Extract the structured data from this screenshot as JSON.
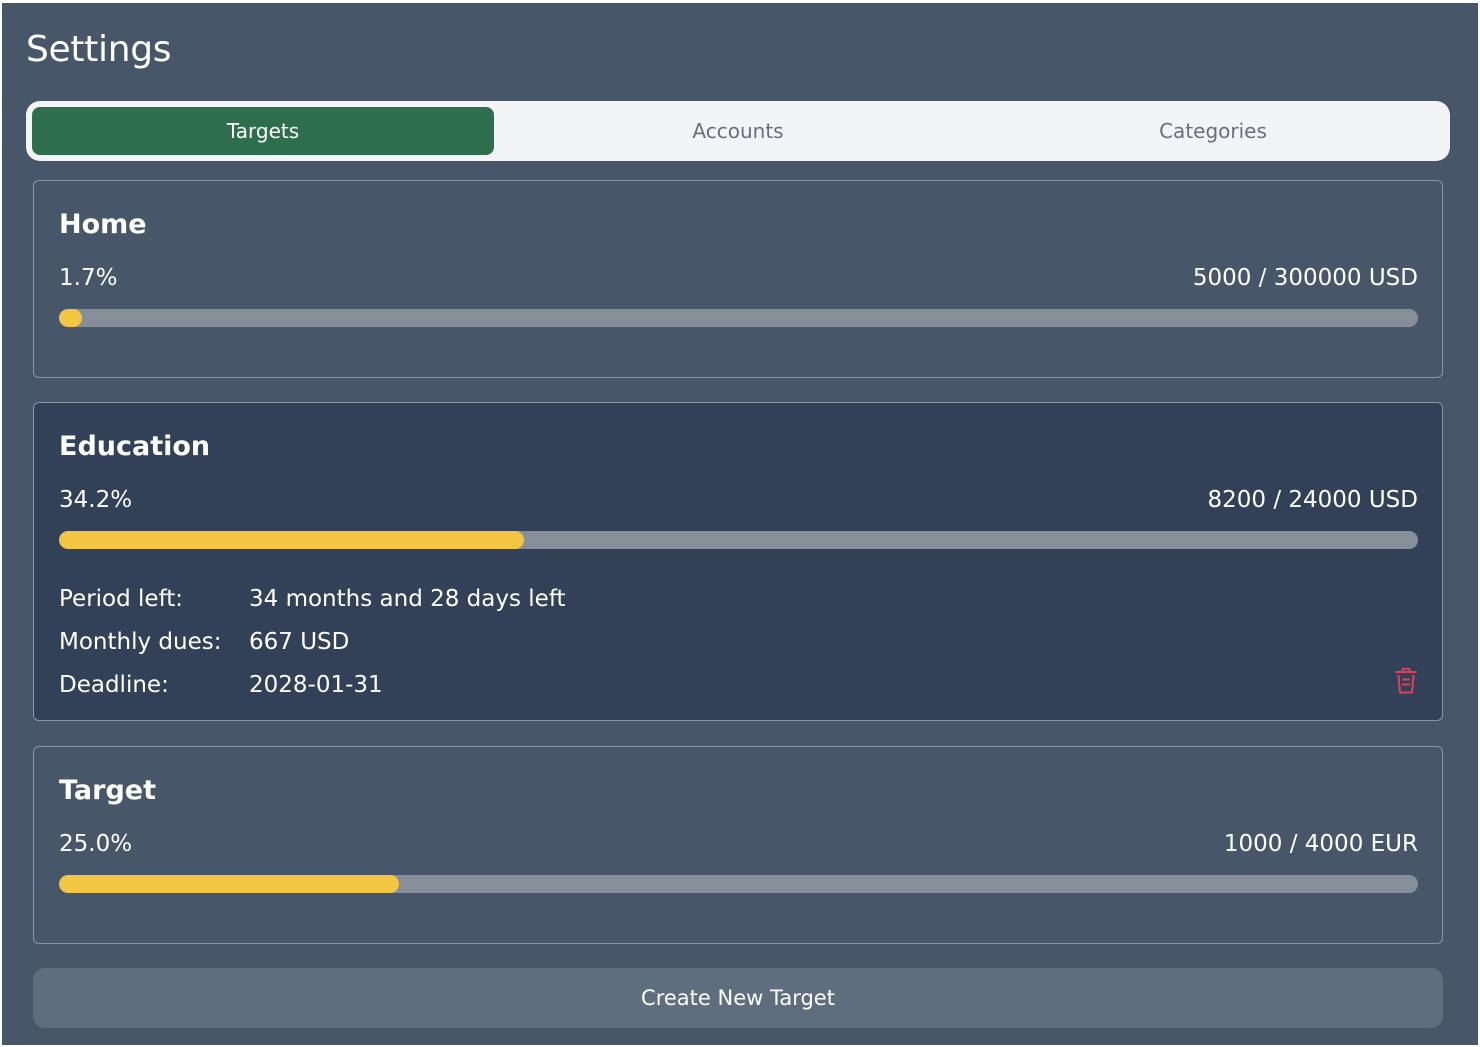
{
  "page": {
    "title": "Settings"
  },
  "tabs": [
    {
      "label": "Targets",
      "active": true
    },
    {
      "label": "Accounts",
      "active": false
    },
    {
      "label": "Categories",
      "active": false
    }
  ],
  "targets": [
    {
      "name": "Home",
      "percent_label": "1.7%",
      "amount_label": "5000 / 300000 USD",
      "progress": 0.017
    },
    {
      "name": "Education",
      "percent_label": "34.2%",
      "amount_label": "8200 / 24000 USD",
      "progress": 0.342,
      "expanded": true,
      "details": [
        {
          "label": "Period left:",
          "value": "34 months and 28 days left"
        },
        {
          "label": "Monthly dues:",
          "value": "667 USD"
        },
        {
          "label": "Deadline:",
          "value": "2028-01-31"
        }
      ],
      "delete_icon": "trash-icon"
    },
    {
      "name": "Target",
      "percent_label": "25.0%",
      "amount_label": "1000 / 4000 EUR",
      "progress": 0.25
    }
  ],
  "actions": {
    "create_label": "Create New Target"
  },
  "colors": {
    "background": "#475769",
    "active_tab": "#2e6e4c",
    "progress_fill": "#f4c542",
    "progress_track": "#868e99",
    "expanded_card": "#324158",
    "delete": "#e0405a",
    "button": "#5f6e7e"
  }
}
